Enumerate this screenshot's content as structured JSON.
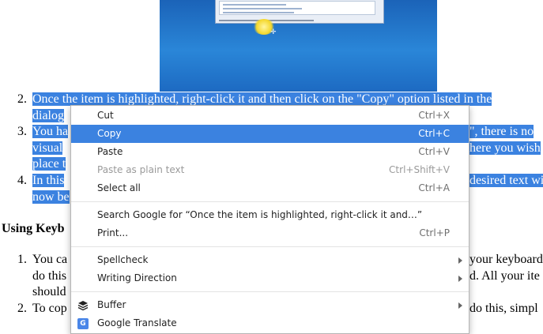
{
  "steps": [
    {
      "num": "2.",
      "lines": [
        "Once the item is highlighted, right-click it and then click on the \"Copy\" option listed in the",
        "dialog"
      ]
    },
    {
      "num": "3.",
      "lines": [
        "You ha",
        "\", there is no",
        "visual",
        "here you wish",
        "place t"
      ]
    },
    {
      "num": "4.",
      "lines": [
        "In this",
        "desired text wi",
        "now be"
      ]
    }
  ],
  "subheading": "Using Keyb",
  "list2": [
    {
      "num": "1.",
      "lines": [
        "You ca",
        "your keyboard",
        "do this",
        "d. All your ite",
        "should"
      ]
    },
    {
      "num": "2.",
      "lines": [
        "To cop",
        "do this, simpl"
      ]
    }
  ],
  "menu": {
    "items": [
      {
        "label": "Cut",
        "shortcut": "Ctrl+X"
      },
      {
        "label": "Copy",
        "shortcut": "Ctrl+C"
      },
      {
        "label": "Paste",
        "shortcut": "Ctrl+V"
      },
      {
        "label": "Paste as plain text",
        "shortcut": "Ctrl+Shift+V"
      },
      {
        "label": "Select all",
        "shortcut": "Ctrl+A"
      },
      {
        "label": "Search Google for “Once the item is highlighted, right-click it and…”"
      },
      {
        "label": "Print...",
        "shortcut": "Ctrl+P"
      },
      {
        "label": "Spellcheck"
      },
      {
        "label": "Writing Direction"
      },
      {
        "label": "Buffer"
      },
      {
        "label": "Google Translate"
      }
    ]
  },
  "colors": {
    "selection": "#3b82e0",
    "menu_highlight": "#3b82e0"
  }
}
